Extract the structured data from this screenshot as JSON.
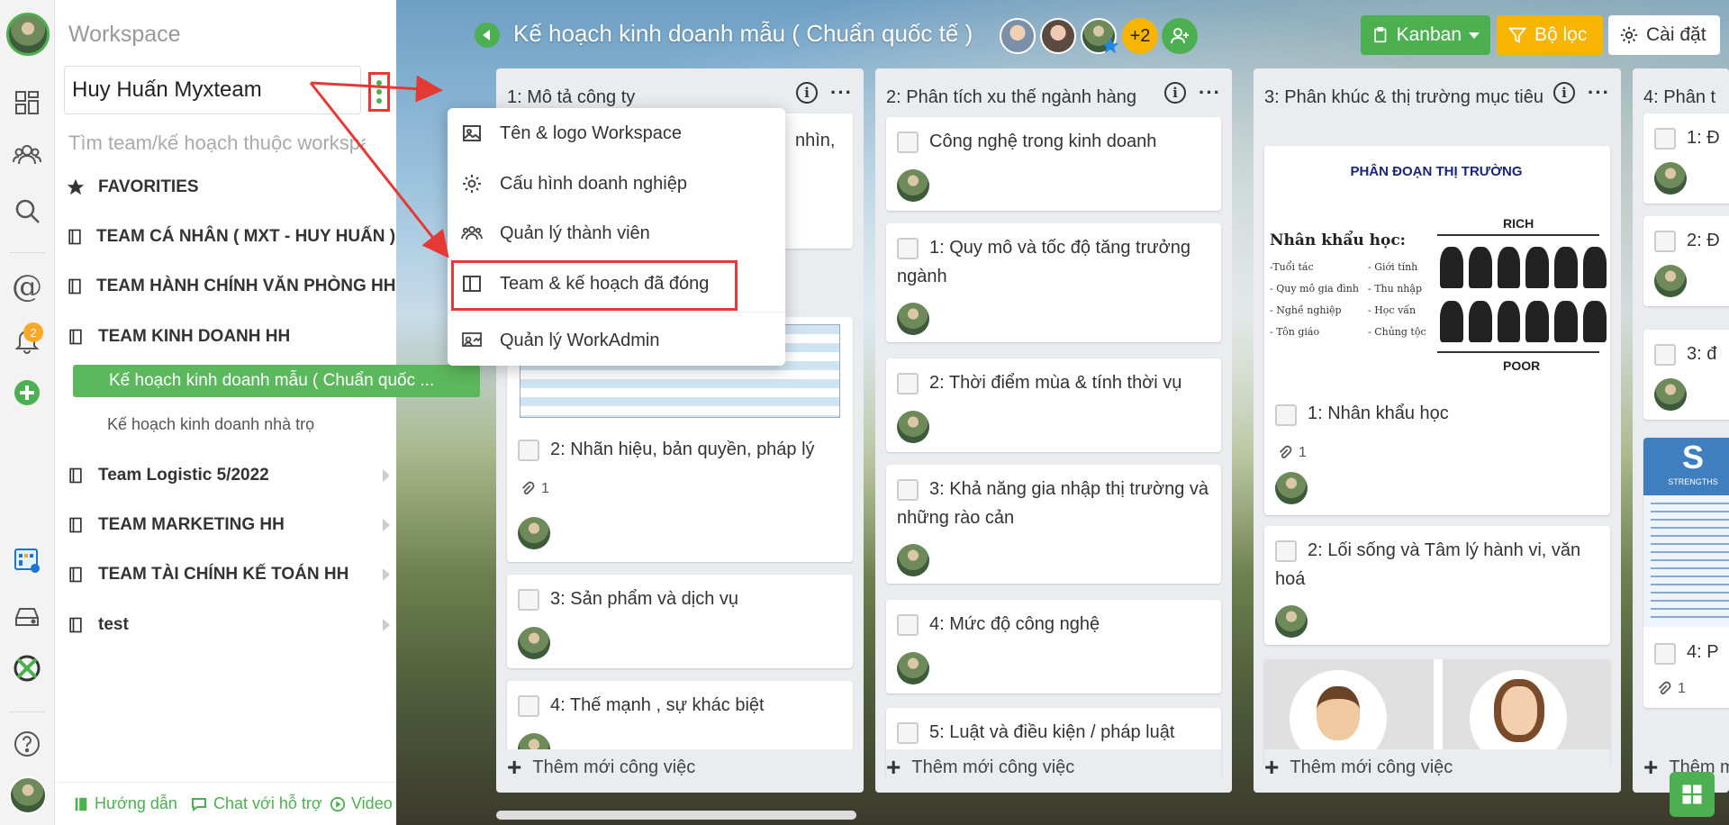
{
  "sidebar": {
    "title": "Workspace",
    "workspace_name": "Huy Huấn Myxteam",
    "search_placeholder": "Tìm team/kế hoạch thuộc workspace...",
    "favorites": "FAVORITIES",
    "teams": [
      "TEAM CÁ NHÂN ( MXT - HUY HUẤN )",
      "TEAM HÀNH CHÍNH VĂN PHÒNG HH",
      "TEAM KINH DOANH HH"
    ],
    "plans": [
      "Kế hoạch kinh doanh mẫu ( Chuẩn quốc ...",
      "Kế hoạch kinh doanh nhà trọ"
    ],
    "more_teams": [
      "Team Logistic 5/2022",
      "TEAM MARKETING HH",
      "TEAM TÀI CHÍNH KẾ TOÁN HH",
      "test"
    ],
    "footer": {
      "guide": "Hướng dẫn",
      "chat": "Chat với hỗ trợ",
      "video": "Video"
    }
  },
  "rail": {
    "notification_count": "2"
  },
  "popup": {
    "items": [
      "Tên & logo Workspace",
      "Cấu hình doanh nghiệp",
      "Quản lý thành viên",
      "Team & kế hoạch đã đóng",
      "Quản lý WorkAdmin"
    ]
  },
  "header": {
    "board_title": "Kế hoạch kinh doanh mẫu ( Chuẩn quốc tế )",
    "more_members": "+2",
    "view_label": "Kanban",
    "filter_label": "Bộ lọc",
    "settings_label": "Cài đặt"
  },
  "columns": [
    {
      "title": "1: Mô tả công ty",
      "cards": [
        {
          "text": "nhìn,"
        },
        {
          "text": "2: Nhãn hiệu, bản quyền, pháp lý",
          "attachments": "1"
        },
        {
          "text": "3: Sản phẩm và dịch vụ"
        },
        {
          "text": "4: Thế mạnh , sự khác biệt"
        }
      ]
    },
    {
      "title": "2: Phân tích xu thế ngành hàng",
      "cards": [
        {
          "text": "Công nghệ trong kinh doanh"
        },
        {
          "text": "1: Quy mô và tốc độ tăng trưởng ngành"
        },
        {
          "text": "2: Thời điểm mùa & tính thời vụ"
        },
        {
          "text": "3: Khả năng gia nhập thị trường và những rào cản"
        },
        {
          "text": "4: Mức độ công nghệ"
        },
        {
          "text": "5: Luật và điều kiện / pháp luật"
        }
      ]
    },
    {
      "title": "3: Phân khúc & thị trường mục tiêu",
      "image": {
        "heading": "PHÂN ĐOẠN THỊ TRƯỜNG",
        "sub": "Nhân khẩu học:",
        "left_list": [
          "-Tuổi tác",
          "- Quy mô gia đình",
          "- Nghề nghiệp",
          "- Tôn giáo"
        ],
        "right_list": [
          "- Giới tính",
          "- Thu nhập",
          "- Học vấn",
          "- Chủng tộc"
        ],
        "rich": "RICH",
        "poor": "POOR"
      },
      "cards": [
        {
          "text": "1: Nhân khẩu học",
          "attachments": "1"
        },
        {
          "text": "2: Lối sống và Tâm lý hành vi, văn hoá"
        }
      ]
    },
    {
      "title": "4: Phân t",
      "cards": [
        {
          "text": "1: Đ"
        },
        {
          "text": "2: Đ"
        },
        {
          "text": "3: đ"
        },
        {
          "text": "4: P",
          "attachments": "1"
        }
      ],
      "strength_letter": "S",
      "strength_label": "STRENGTHS"
    }
  ],
  "add_task_label": "Thêm mới công việc",
  "colors": {
    "accent": "#4caf50",
    "filter": "#f7b500",
    "highlight": "#e53935"
  }
}
